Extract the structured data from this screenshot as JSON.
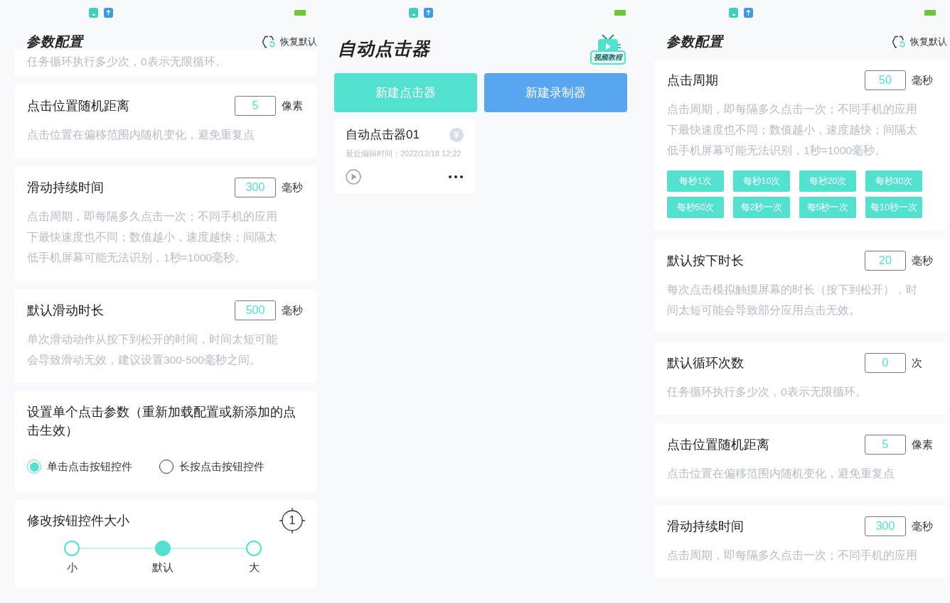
{
  "panels": [
    {
      "kind": "settings",
      "title": "参数配置",
      "reset_label": "恢复默认",
      "cards": [
        {
          "kind": "note",
          "description": "任务循环执行多少次，0表示无限循环。"
        },
        {
          "kind": "number",
          "label": "点击位置随机距离",
          "value": "5",
          "unit": "像素",
          "description": "点击位置在偏移范围内随机变化，避免重复点"
        },
        {
          "kind": "number",
          "label": "滑动持续时间",
          "value": "300",
          "unit": "毫秒",
          "description": "点击周期，即每隔多久点击一次；不同手机的应用下最快速度也不同；数值越小，速度越快；间隔太低手机屏幕可能无法识别，1秒=1000毫秒。"
        },
        {
          "kind": "number",
          "label": "默认滑动时长",
          "value": "500",
          "unit": "毫秒",
          "description": "单次滑动动作从按下到松开的时间，时间太短可能会导致滑动无效，建议设置300-500毫秒之间。"
        },
        {
          "kind": "radio",
          "label": "设置单个点击参数（重新加载配置或新添加的点击生效）",
          "options": [
            {
              "label": "单击点击按钮控件",
              "selected": true
            },
            {
              "label": "长按点击按钮控件",
              "selected": false
            }
          ]
        },
        {
          "kind": "size",
          "label": "修改按钮控件大小",
          "badge": "1",
          "options": [
            {
              "label": "小",
              "selected": false
            },
            {
              "label": "默认",
              "selected": true
            },
            {
              "label": "大",
              "selected": false
            }
          ]
        }
      ]
    },
    {
      "kind": "home",
      "title": "自动点击器",
      "tutorial_label": "视频教程",
      "buttons": [
        {
          "label": "新建点击器",
          "color": "#52e0cf"
        },
        {
          "label": "新建录制器",
          "color": "#57a6ee"
        }
      ],
      "clickers": [
        {
          "name": "自动点击器01",
          "edited": "最近编辑时间：2022/12/18 12:22"
        }
      ]
    },
    {
      "kind": "settings",
      "title": "参数配置",
      "reset_label": "恢复默认",
      "cards": [
        {
          "kind": "presets",
          "label": "点击周期",
          "value": "50",
          "unit": "毫秒",
          "description": "点击周期，即每隔多久点击一次；不同手机的应用下最快速度也不同；数值越小，速度越快；间隔太低手机屏幕可能无法识别，1秒=1000毫秒。",
          "presets": [
            "每秒1次",
            "每秒10次",
            "每秒20次",
            "每秒30次",
            "每秒50次",
            "每2秒一次",
            "每5秒一次",
            "每10秒一次"
          ]
        },
        {
          "kind": "number",
          "label": "默认按下时长",
          "value": "20",
          "unit": "毫秒",
          "description": "每次点击模拟触摸屏幕的时长（按下到松开），时间太短可能会导致部分应用点击无效。"
        },
        {
          "kind": "number",
          "label": "默认循环次数",
          "value": "0",
          "unit": "次",
          "description": "任务循环执行多少次，0表示无限循环。"
        },
        {
          "kind": "number",
          "label": "点击位置随机距离",
          "value": "5",
          "unit": "像素",
          "description": "点击位置在偏移范围内随机变化，避免重复点"
        },
        {
          "kind": "number",
          "label": "滑动持续时间",
          "value": "300",
          "unit": "毫秒",
          "description": "点击周期，即每隔多久点击一次；不同手机的应用"
        }
      ]
    }
  ]
}
